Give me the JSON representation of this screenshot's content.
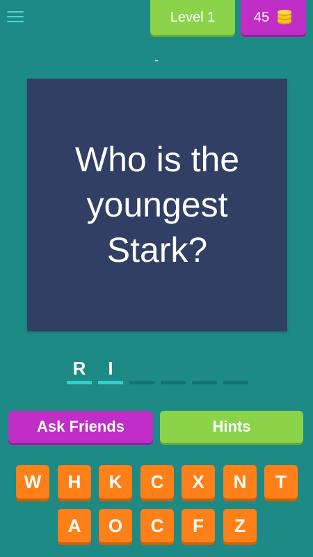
{
  "header": {
    "level_label": "Level 1",
    "coins": "45",
    "menu_icon": "hamburger-menu-icon",
    "coin_icon": "coin-stack-icon",
    "coin_color": "#f5c518"
  },
  "question": {
    "hint_text": "-",
    "text": "Who is the youngest Stark?"
  },
  "answer": {
    "slots": [
      "R",
      "I",
      "",
      "",
      "",
      ""
    ]
  },
  "actions": {
    "ask_friends_label": "Ask Friends",
    "hints_label": "Hints"
  },
  "keyboard": {
    "row1": [
      "W",
      "H",
      "K",
      "C",
      "X",
      "N",
      "T"
    ],
    "row2": [
      "A",
      "O",
      "C",
      "F",
      "Z"
    ]
  },
  "colors": {
    "background": "#1e8a86",
    "card": "#303f63",
    "green": "#8bd44a",
    "purple": "#c02dc7",
    "orange": "#ff7f18",
    "slot_active": "#2fd0cd"
  }
}
